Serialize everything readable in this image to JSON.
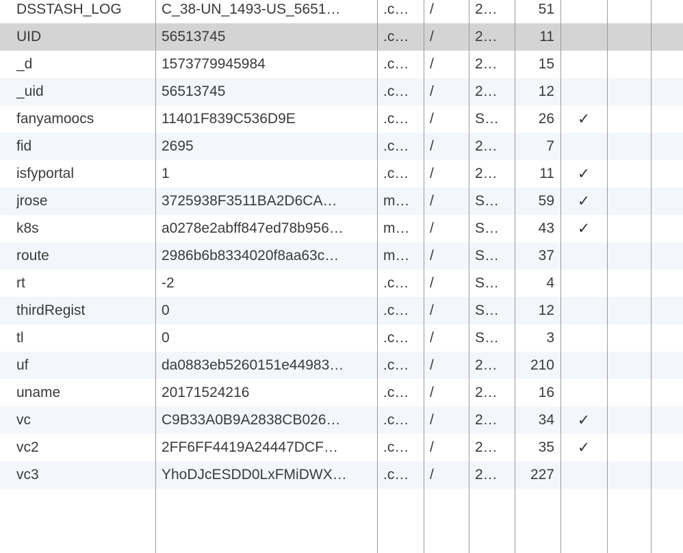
{
  "cookies": [
    {
      "name": "DSSTASH_LOG",
      "value": "C_38-UN_1493-US_5651…",
      "domain": ".c…",
      "path": "/",
      "expires": "2…",
      "size": "51",
      "http_only": ""
    },
    {
      "name": "UID",
      "value": "56513745",
      "domain": ".c…",
      "path": "/",
      "expires": "2…",
      "size": "11",
      "http_only": ""
    },
    {
      "name": "_d",
      "value": "1573779945984",
      "domain": ".c…",
      "path": "/",
      "expires": "2…",
      "size": "15",
      "http_only": ""
    },
    {
      "name": "_uid",
      "value": "56513745",
      "domain": ".c…",
      "path": "/",
      "expires": "2…",
      "size": "12",
      "http_only": ""
    },
    {
      "name": "fanyamoocs",
      "value": "11401F839C536D9E",
      "domain": ".c…",
      "path": "/",
      "expires": "S…",
      "size": "26",
      "http_only": "✓"
    },
    {
      "name": "fid",
      "value": "2695",
      "domain": ".c…",
      "path": "/",
      "expires": "2…",
      "size": "7",
      "http_only": ""
    },
    {
      "name": "isfyportal",
      "value": "1",
      "domain": ".c…",
      "path": "/",
      "expires": "2…",
      "size": "11",
      "http_only": "✓"
    },
    {
      "name": "jrose",
      "value": "3725938F3511BA2D6CA…",
      "domain": "m…",
      "path": "/",
      "expires": "S…",
      "size": "59",
      "http_only": "✓"
    },
    {
      "name": "k8s",
      "value": "a0278e2abff847ed78b956…",
      "domain": "m…",
      "path": "/",
      "expires": "S…",
      "size": "43",
      "http_only": "✓"
    },
    {
      "name": "route",
      "value": "2986b6b8334020f8aa63c…",
      "domain": "m…",
      "path": "/",
      "expires": "S…",
      "size": "37",
      "http_only": ""
    },
    {
      "name": "rt",
      "value": "-2",
      "domain": ".c…",
      "path": "/",
      "expires": "S…",
      "size": "4",
      "http_only": ""
    },
    {
      "name": "thirdRegist",
      "value": "0",
      "domain": ".c…",
      "path": "/",
      "expires": "S…",
      "size": "12",
      "http_only": ""
    },
    {
      "name": "tl",
      "value": "0",
      "domain": ".c…",
      "path": "/",
      "expires": "S…",
      "size": "3",
      "http_only": ""
    },
    {
      "name": "uf",
      "value": "da0883eb5260151e44983…",
      "domain": ".c…",
      "path": "/",
      "expires": "2…",
      "size": "210",
      "http_only": ""
    },
    {
      "name": "uname",
      "value": "20171524216",
      "domain": ".c…",
      "path": "/",
      "expires": "2…",
      "size": "16",
      "http_only": ""
    },
    {
      "name": "vc",
      "value": "C9B33A0B9A2838CB026…",
      "domain": ".c…",
      "path": "/",
      "expires": "2…",
      "size": "34",
      "http_only": "✓"
    },
    {
      "name": "vc2",
      "value": "2FF6FF4419A24447DCF…",
      "domain": ".c…",
      "path": "/",
      "expires": "2…",
      "size": "35",
      "http_only": "✓"
    },
    {
      "name": "vc3",
      "value": "YhoDJcESDD0LxFMiDWX…",
      "domain": ".c…",
      "path": "/",
      "expires": "2…",
      "size": "227",
      "http_only": ""
    }
  ],
  "selected_row": 1,
  "colors": {
    "row_stripe": "#f3f6fa",
    "row_selected": "#d4d4d4",
    "grid_line": "#9a9a9a",
    "text": "#3a3a3a"
  }
}
